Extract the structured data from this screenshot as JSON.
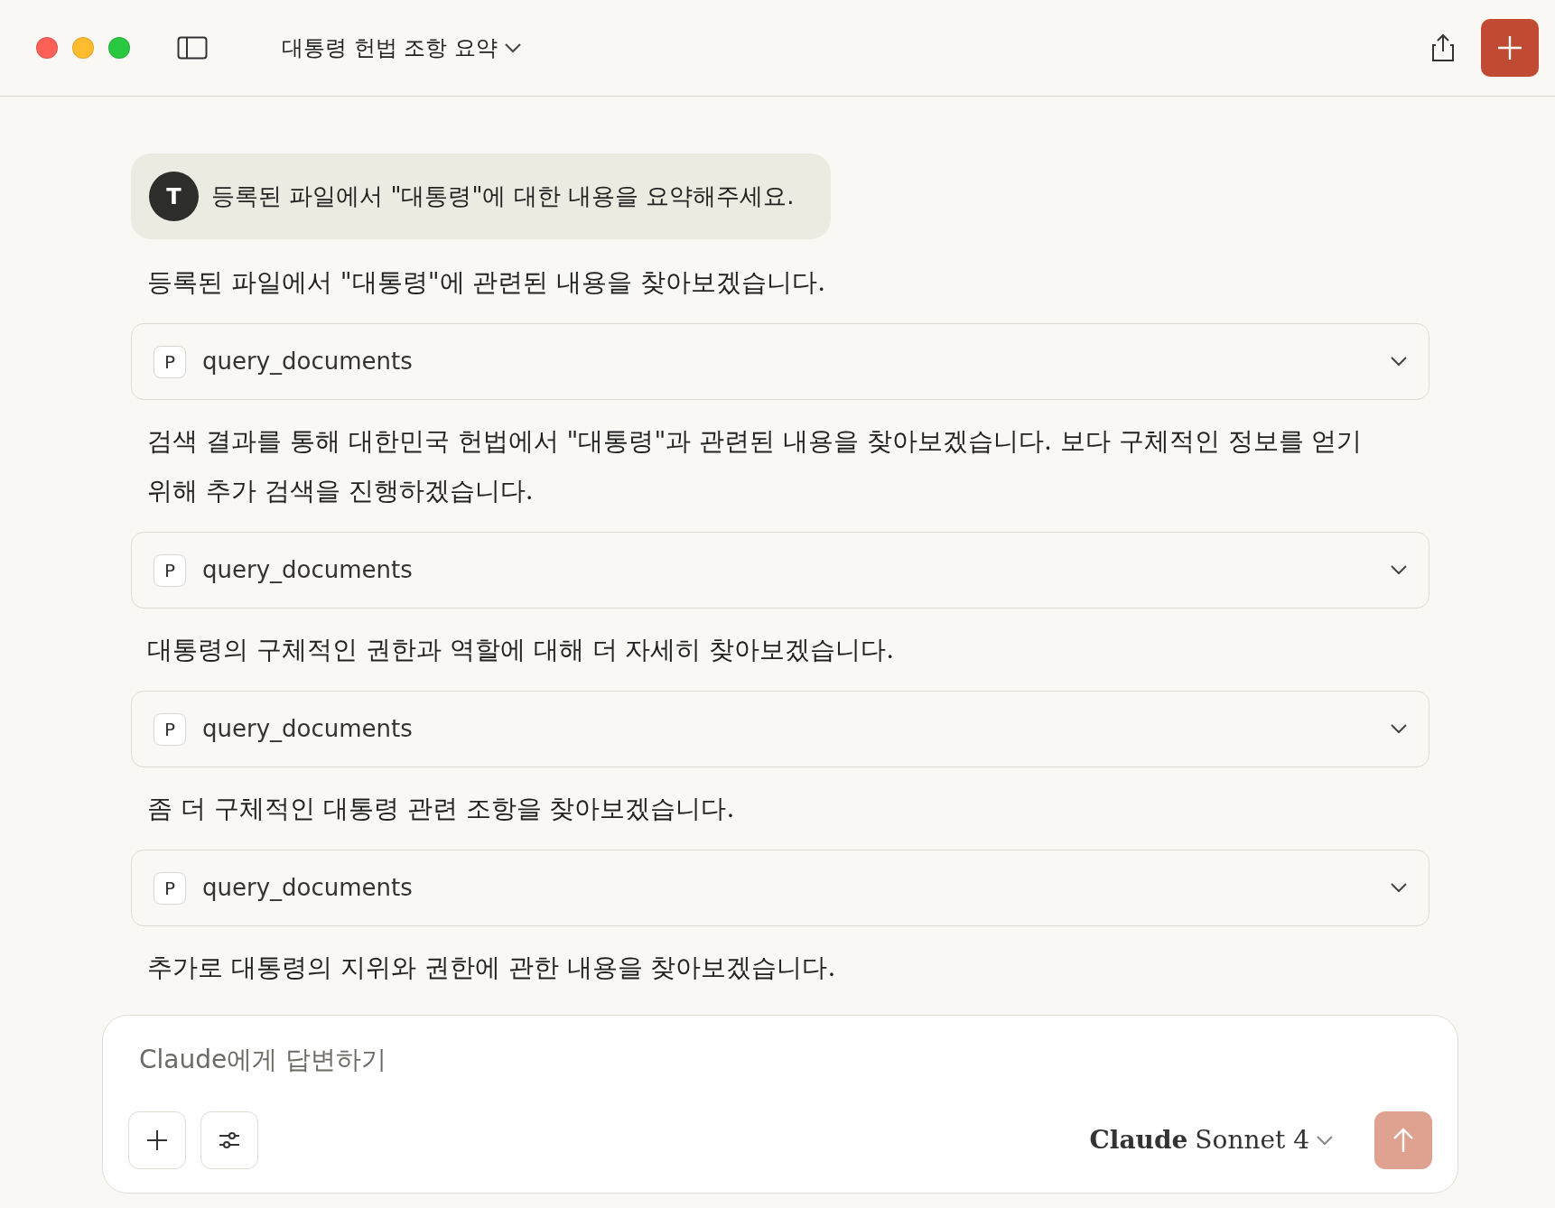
{
  "window": {
    "title": "대통령 헌법 조항 요약"
  },
  "messages": [
    {
      "kind": "user",
      "avatar": "T",
      "text": "등록된 파일에서 \"대통령\"에 대한 내용을 요약해주세요."
    },
    {
      "kind": "assistant",
      "text": "등록된 파일에서 \"대통령\"에 관련된 내용을 찾아보겠습니다."
    },
    {
      "kind": "tool",
      "badge": "P",
      "name": "query_documents",
      "expanded": false
    },
    {
      "kind": "assistant",
      "text": "검색 결과를 통해 대한민국 헌법에서 \"대통령\"과 관련된 내용을 찾아보겠습니다. 보다 구체적인 정보를 얻기 위해 추가 검색을 진행하겠습니다."
    },
    {
      "kind": "tool",
      "badge": "P",
      "name": "query_documents",
      "expanded": false
    },
    {
      "kind": "assistant",
      "text": "대통령의 구체적인 권한과 역할에 대해 더 자세히 찾아보겠습니다."
    },
    {
      "kind": "tool",
      "badge": "P",
      "name": "query_documents",
      "expanded": false
    },
    {
      "kind": "assistant",
      "text": "좀 더 구체적인 대통령 관련 조항을 찾아보겠습니다."
    },
    {
      "kind": "tool",
      "badge": "P",
      "name": "query_documents",
      "expanded": false
    },
    {
      "kind": "assistant",
      "text": "추가로 대통령의 지위와 권한에 관한 내용을 찾아보겠습니다."
    }
  ],
  "composer": {
    "placeholder": "Claude에게 답변하기",
    "model_brand": "Claude",
    "model_name": "Sonnet 4",
    "send_disabled": true
  }
}
